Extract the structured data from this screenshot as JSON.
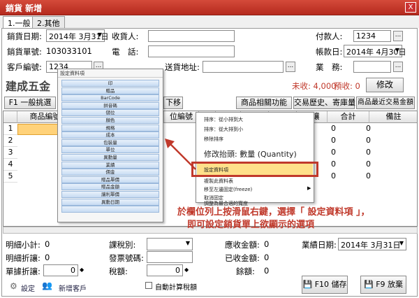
{
  "window": {
    "title": "銷貨 新增",
    "close_label": "X"
  },
  "tabs": [
    {
      "label": "1.一般"
    },
    {
      "label": "2.其他"
    }
  ],
  "form": {
    "date_label": "銷貨日期:",
    "date_value": "2014年 3月31日",
    "order_no_label": "銷貨單號:",
    "order_no_value": "103033101",
    "customer_no_label": "客戶編號:",
    "customer_no_value": "1234",
    "receiver_label": "收貨人:",
    "receiver_value": "",
    "phone_label": "電　話:",
    "phone_value": "",
    "address_label": "送貨地址:",
    "address_value": "",
    "payer_label": "付款人:",
    "payer_value": "1234",
    "account_date_label": "帳款日:",
    "account_date_value": "2014年 4月30日",
    "sales_label": "業　務:",
    "sales_value": "",
    "dots": "...",
    "company_name": "建成五金",
    "unpaid_label": "未收: 4,000",
    "prepaid_label": "預收: 0",
    "modify_button": "修改"
  },
  "toolbar": {
    "f1_label": "F1 一般挑選",
    "f1b_label": "F1",
    "down_label": "下移",
    "related_label": "商品相關功能",
    "history_label": "交易歷史、寄庫量",
    "recent_label": "商品最近交易金額"
  },
  "grid": {
    "headers": [
      "",
      "商品編號",
      "",
      "位編號",
      "數量",
      "",
      "",
      "",
      "折讓",
      "合計",
      "備註"
    ],
    "rows": [
      "1",
      "2",
      "3",
      "4",
      "5"
    ],
    "zero": "0"
  },
  "popup": {
    "title": "設定資料項",
    "items": [
      "印",
      "贈品",
      "BarCode",
      "拼音碼",
      "儲位",
      "顏色",
      "規格",
      "成本",
      "包裝量",
      "單位",
      "異動量",
      "業績",
      "佣金",
      "贈品單價",
      "贈品金額",
      "讓利單價",
      "異動日期",
      ""
    ]
  },
  "context_menu": {
    "items": [
      "排序：從小排到大",
      "排序：從大排到小",
      "移除排序",
      "修改抬頭: 數量 (Quantity)",
      "設定資料項",
      "複製此資料表",
      "移至左邊固定(freeze)",
      "取消固定",
      "調整為最合適的寬度"
    ]
  },
  "annotation": {
    "line1": "於欄位列上按滑鼠右鍵，選擇「 設定資料項 」，",
    "line2": "即可設定銷貨單上欲顯示的選項"
  },
  "bottom": {
    "subtotal_label": "明細小計:",
    "subtotal_value": "0",
    "discount_label": "明細折讓:",
    "discount_value": "0",
    "single_discount_label": "單據折讓:",
    "single_discount_value": "0",
    "tax_type_label": "課稅別:",
    "tax_type_value": "",
    "invoice_label": "發票號碼:",
    "invoice_value": "",
    "tax_label": "稅額:",
    "tax_value": "0",
    "receivable_label": "應收金額:",
    "receivable_value": "0",
    "received_label": "已收金額:",
    "received_value": "0",
    "balance_label": "餘額:",
    "balance_value": "0",
    "biz_date_label": "業績日期:",
    "biz_date_value": "2014年 3月31日",
    "auto_tax_label": "自動計算稅額",
    "settings_label": "設定",
    "new_customer_label": "新增客戶",
    "save_label": "F10 儲存",
    "cancel_label": "F9 放棄"
  },
  "colors": {
    "titlebar": "#c0392b",
    "annotation": "#c0392b",
    "unpaid": "#c0392b",
    "selected_cell": "#ffd27a"
  }
}
